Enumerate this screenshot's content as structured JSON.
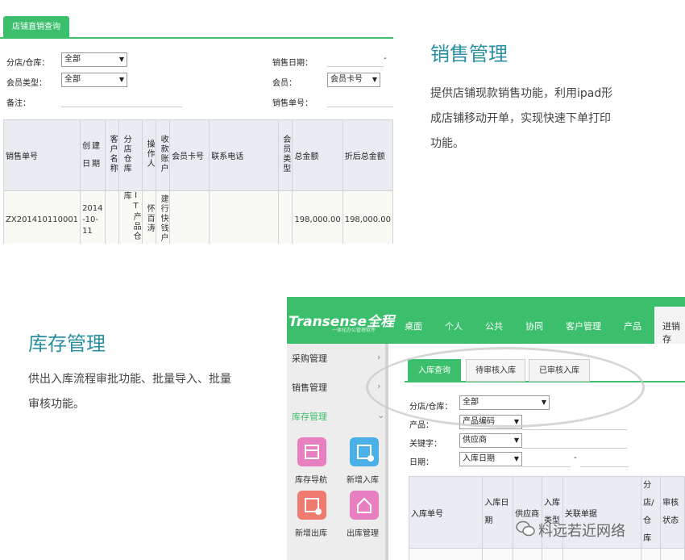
{
  "shot1": {
    "tab": "店铺直销查询",
    "fields": {
      "store_label": "分店/仓库：",
      "store_value": "全部",
      "member_type_label": "会员类型：",
      "member_type_value": "全部",
      "note_label": "备注：",
      "sale_date_label": "销售日期：",
      "date_sep": "-",
      "member_label": "会员：",
      "member_select": "会员卡号",
      "sale_no_label": "销售单号："
    },
    "columns": [
      "销售单号",
      "创建日期",
      "客户名称",
      "分店仓库",
      "操作人",
      "收款账户",
      "会员卡号",
      "联系电话",
      "会员类型",
      "总金额",
      "折后总金额"
    ],
    "row": {
      "sale_no": "ZX201410110001",
      "date": "2014-10-11",
      "store": "IT产品仓库",
      "operator": "怀百涛",
      "account": "建行快钱户",
      "total": "198,000.00",
      "discounted": "198,000.00"
    }
  },
  "sales": {
    "title": "销售管理",
    "desc1": "提供店铺现款销售功能，利用ipad形",
    "desc2": "成店铺移动开单，实现快速下单打印",
    "desc3": "功能。"
  },
  "inventory": {
    "title": "库存管理",
    "desc1": "供出入库流程审批功能、批量导入、批量",
    "desc2": "审核功能。"
  },
  "shot2": {
    "logo": "Transense全程",
    "logo_sub": "一体化办公管理软件",
    "nav": [
      "桌面",
      "个人",
      "公共",
      "协同",
      "客户管理",
      "产品",
      "进销存"
    ],
    "side": [
      "采购管理",
      "销售管理",
      "库存管理"
    ],
    "icons": [
      "库存导航",
      "新增入库",
      "新增出库",
      "出库管理"
    ],
    "tabs": [
      "入库查询",
      "待审核入库",
      "已审核入库"
    ],
    "store_label": "分店/仓库：",
    "store_value": "全部",
    "product_label": "产品：",
    "product_value": "产品编码",
    "keyword_label": "关键字：",
    "keyword_value": "供应商",
    "date_label": "日期：",
    "date_value": "入库日期",
    "date_sep": "-",
    "columns": [
      "入库单号",
      "入库日期",
      "供应商",
      "入库类型",
      "关联单据",
      "分店/仓库",
      "审核状态"
    ]
  },
  "watermark": "料远若近网络",
  "colors": {
    "green": "#3cbf6c",
    "heading": "#2a8fa0"
  }
}
